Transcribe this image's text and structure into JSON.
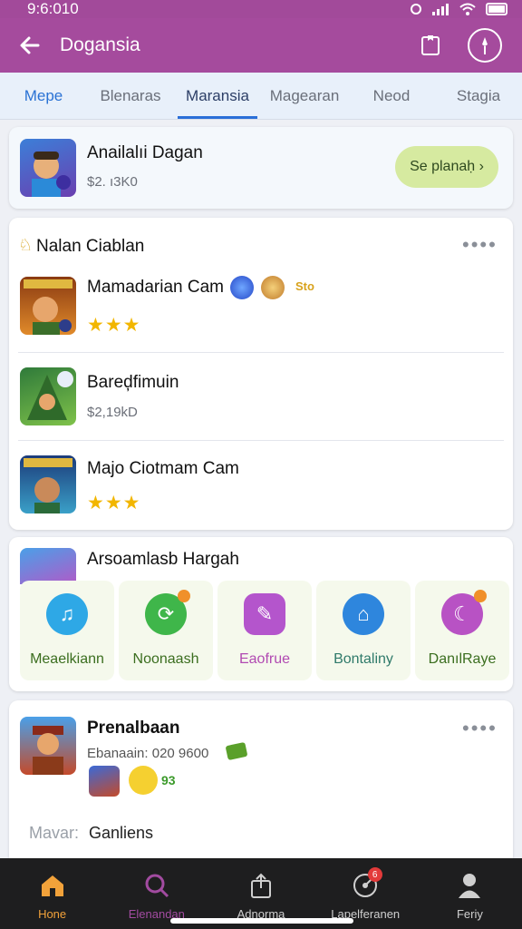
{
  "status": {
    "time": "9:6:010"
  },
  "appbar": {
    "title": "Dogansia"
  },
  "tabs": [
    "Mepe",
    "Blenaras",
    "Maransia",
    "Magearan",
    "Neod",
    "Stagia"
  ],
  "featured": {
    "name": "Anailalıi Dagan",
    "price": "$2. ı3K0",
    "action_label": "Se planaḥ ›"
  },
  "section1": {
    "title": "Nalan Ciablan",
    "items": [
      {
        "name": "Mamadarian Cam",
        "stars": "★★★",
        "extra": "Sto"
      },
      {
        "name": "Bareḑfimuin",
        "sub": "$2,19kD"
      },
      {
        "name": "Majo Ciotmam Cam",
        "stars": "★★★"
      }
    ]
  },
  "section2": {
    "title": "Arsoamlasb Hargah",
    "quick": [
      {
        "label": "Meaelkiann",
        "icon": "music-note-icon",
        "color": "#2ea8e6",
        "label_color": "#3b6e1f"
      },
      {
        "label": "Noonaash",
        "icon": "refresh-icon",
        "color": "#3fb64a",
        "label_color": "#3b6e1f"
      },
      {
        "label": "Eaofrue",
        "icon": "edit-icon",
        "color": "#b455cc",
        "label_color": "#b14ab2"
      },
      {
        "label": "Bontaliny",
        "icon": "house-icon",
        "color": "#2e86dd",
        "label_color": "#2f7a6a"
      },
      {
        "label": "DanılRaye",
        "icon": "planet-icon",
        "color": "#b852c4",
        "label_color": "#3b6e1f"
      }
    ]
  },
  "section3": {
    "title": "Prenalbaan",
    "sub": "Ebanaain: 020 9600",
    "coins": "93",
    "footer_label": "Mavar:",
    "footer_value": "Ganliens"
  },
  "bottom_nav": [
    {
      "label": "Hone",
      "icon": "home-icon"
    },
    {
      "label": "Elenandan",
      "icon": "search-icon"
    },
    {
      "label": "Adnorma",
      "icon": "share-icon"
    },
    {
      "label": "Lapelferanen",
      "icon": "disc-icon",
      "badge": "6"
    },
    {
      "label": "Feriy",
      "icon": "profile-icon"
    }
  ],
  "colors": {
    "brand": "#a54b9d",
    "accent": "#2a6fd8",
    "pill": "#d6eaa0"
  }
}
